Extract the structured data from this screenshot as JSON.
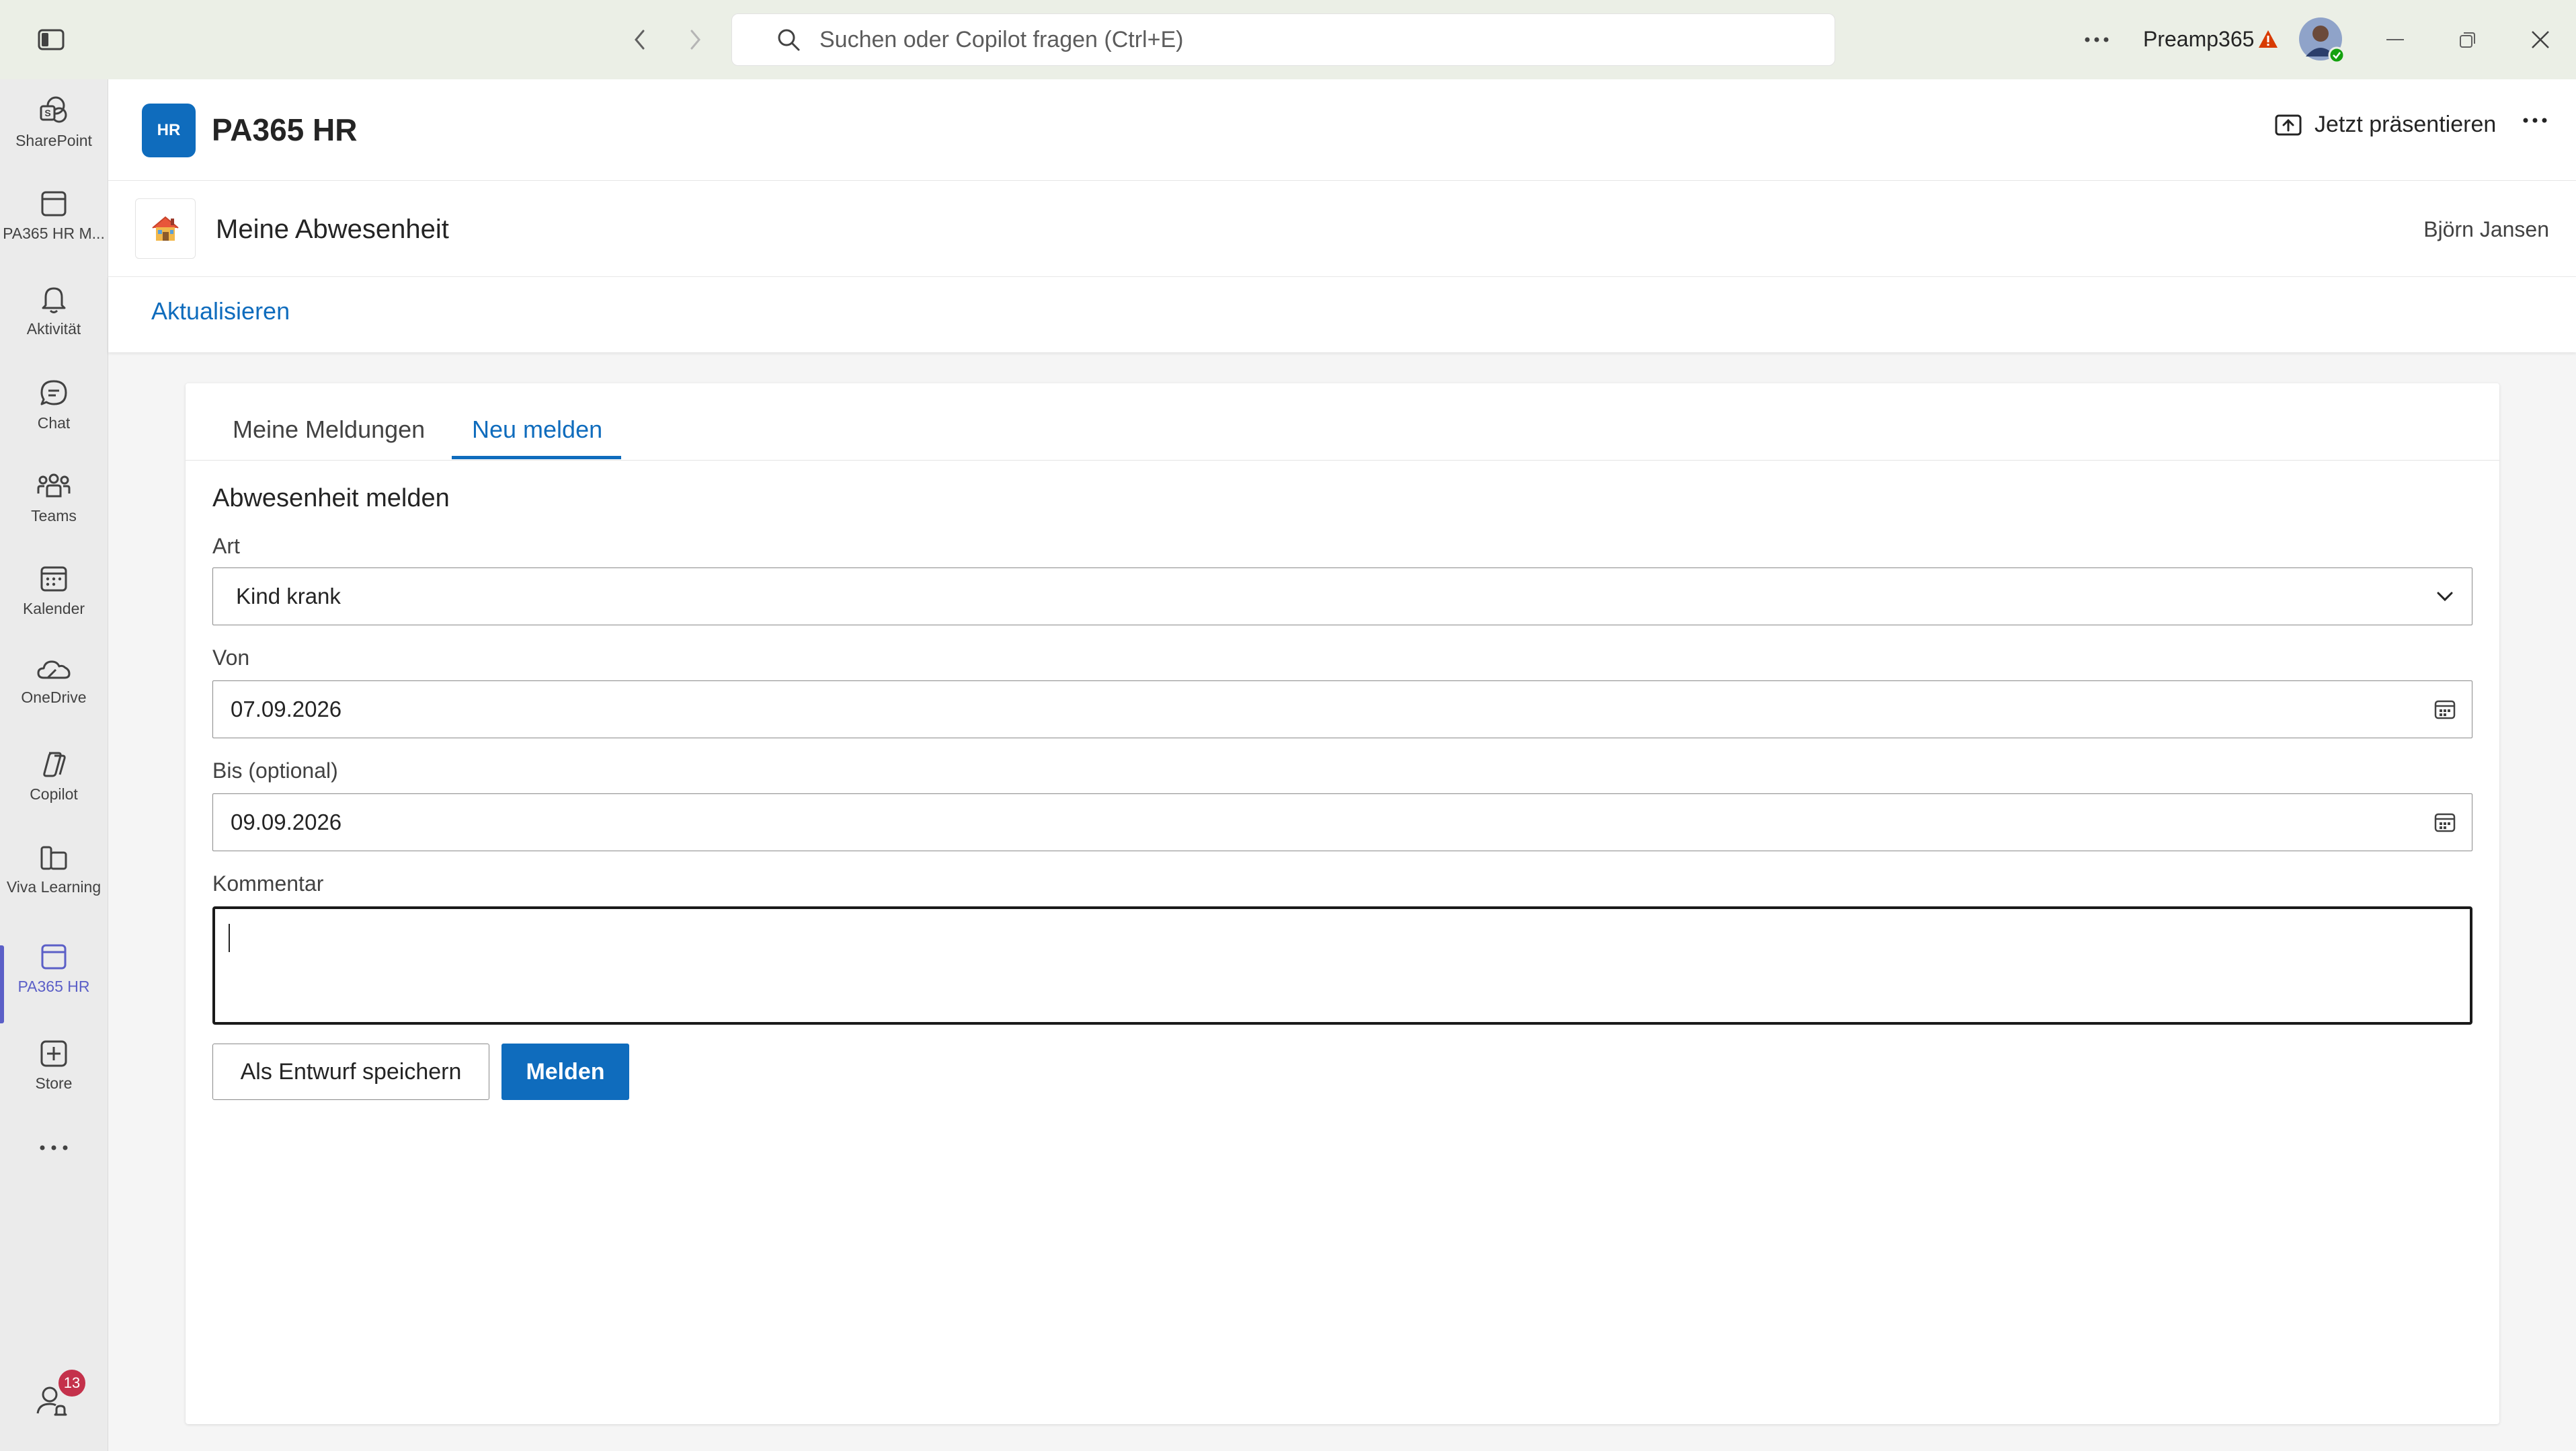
{
  "titlebar": {
    "search_placeholder": "Suchen oder Copilot fragen (Ctrl+E)",
    "account_name": "Preamp365"
  },
  "rail": {
    "items": [
      {
        "label": "SharePoint",
        "icon": "sharepoint-icon"
      },
      {
        "label": "PA365 HR M...",
        "icon": "app-icon"
      },
      {
        "label": "Aktivität",
        "icon": "bell-icon"
      },
      {
        "label": "Chat",
        "icon": "chat-icon"
      },
      {
        "label": "Teams",
        "icon": "teams-icon"
      },
      {
        "label": "Kalender",
        "icon": "calendar-icon"
      },
      {
        "label": "OneDrive",
        "icon": "onedrive-icon"
      },
      {
        "label": "Copilot",
        "icon": "copilot-icon"
      },
      {
        "label": "Viva Learning",
        "icon": "book-icon"
      },
      {
        "label": "PA365 HR",
        "icon": "app-icon"
      },
      {
        "label": "Store",
        "icon": "add-icon"
      }
    ],
    "notification_count": "13"
  },
  "app": {
    "logo_text": "HR",
    "title": "PA365 HR",
    "present_label": "Jetzt präsentieren"
  },
  "page": {
    "title": "Meine Abwesenheit",
    "user": "Björn Jansen",
    "refresh_label": "Aktualisieren"
  },
  "tabs": [
    {
      "label": "Meine Meldungen",
      "active": false
    },
    {
      "label": "Neu melden",
      "active": true
    }
  ],
  "form": {
    "title": "Abwesenheit melden",
    "type_label": "Art",
    "type_value": "Kind krank",
    "from_label": "Von",
    "from_value": "07.09.2026",
    "to_label": "Bis (optional)",
    "to_value": "09.09.2026",
    "comment_label": "Kommentar",
    "comment_value": "",
    "draft_button": "Als Entwurf speichern",
    "submit_button": "Melden"
  },
  "colors": {
    "accent": "#0f6cbd",
    "rail_active": "#5b5fc7",
    "badge": "#c4314b",
    "warning": "#d83b01"
  }
}
